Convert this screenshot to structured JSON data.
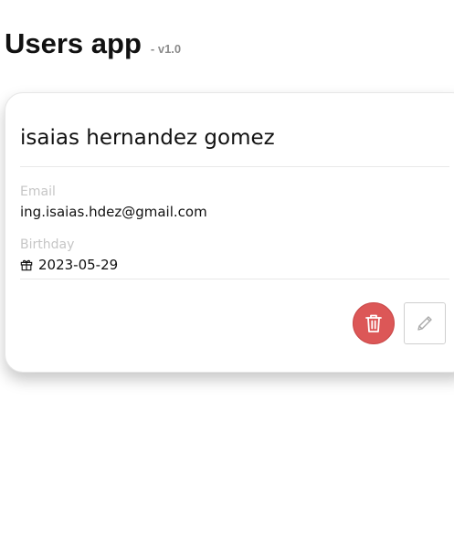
{
  "header": {
    "title": "Users app",
    "version": "- v1.0"
  },
  "user_card": {
    "name": "isaias hernandez gomez",
    "email_label": "Email",
    "email": "ing.isaias.hdez@gmail.com",
    "birthday_label": "Birthday",
    "birthday": "2023-05-29",
    "birthday_icon": "gift-icon",
    "actions": {
      "delete_icon": "trash-icon",
      "edit_icon": "pencil-icon"
    }
  },
  "colors": {
    "delete_button": "#dc5757",
    "label_gray": "#c6c6c6",
    "version_gray": "#8c8c8c"
  }
}
